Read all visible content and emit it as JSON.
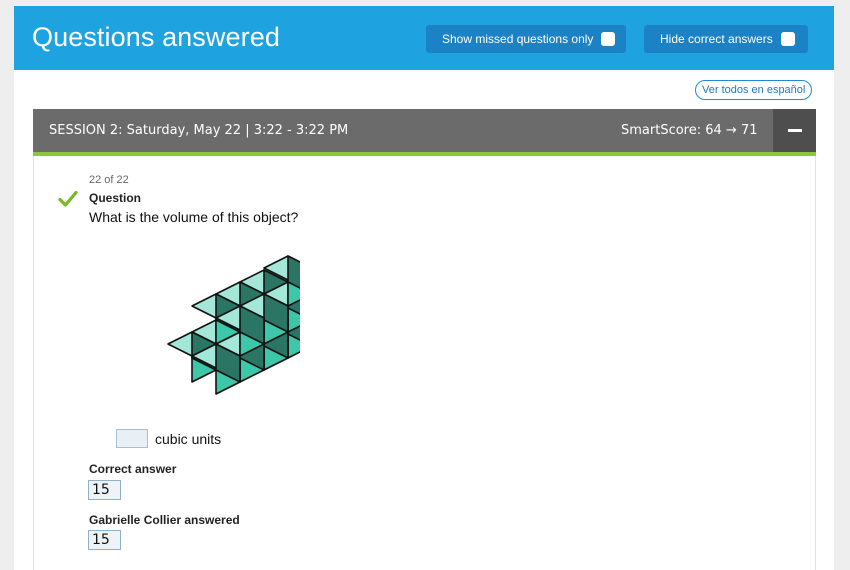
{
  "header": {
    "title": "Questions answered",
    "missed_only_label": "Show missed questions only",
    "hide_correct_label": "Hide correct answers"
  },
  "spanish_link": "Ver todos en español",
  "session": {
    "title": "SESSION 2: Saturday, May 22 | 3:22 - 3:22 PM",
    "smartscore": "SmartScore: 64 → 71"
  },
  "question": {
    "counter": "22 of 22",
    "label": "Question",
    "text": "What is the volume of this object?",
    "input_value": "",
    "unit": "cubic units"
  },
  "correct": {
    "label": "Correct answer",
    "value": "15"
  },
  "student": {
    "label": "Gabrielle Collier answered",
    "value": "15"
  },
  "colors": {
    "header_bg": "#1fa3e0",
    "button_bg": "#1a82c5",
    "session_bar": "#6b6b6b",
    "session_accent": "#8cc63f",
    "check": "#7ab829",
    "cube_top": "#a4e6d8",
    "cube_left": "#3cc7a8",
    "cube_right": "#2a7563"
  },
  "icons": {
    "check": "check-icon",
    "collapse": "minus-icon"
  }
}
